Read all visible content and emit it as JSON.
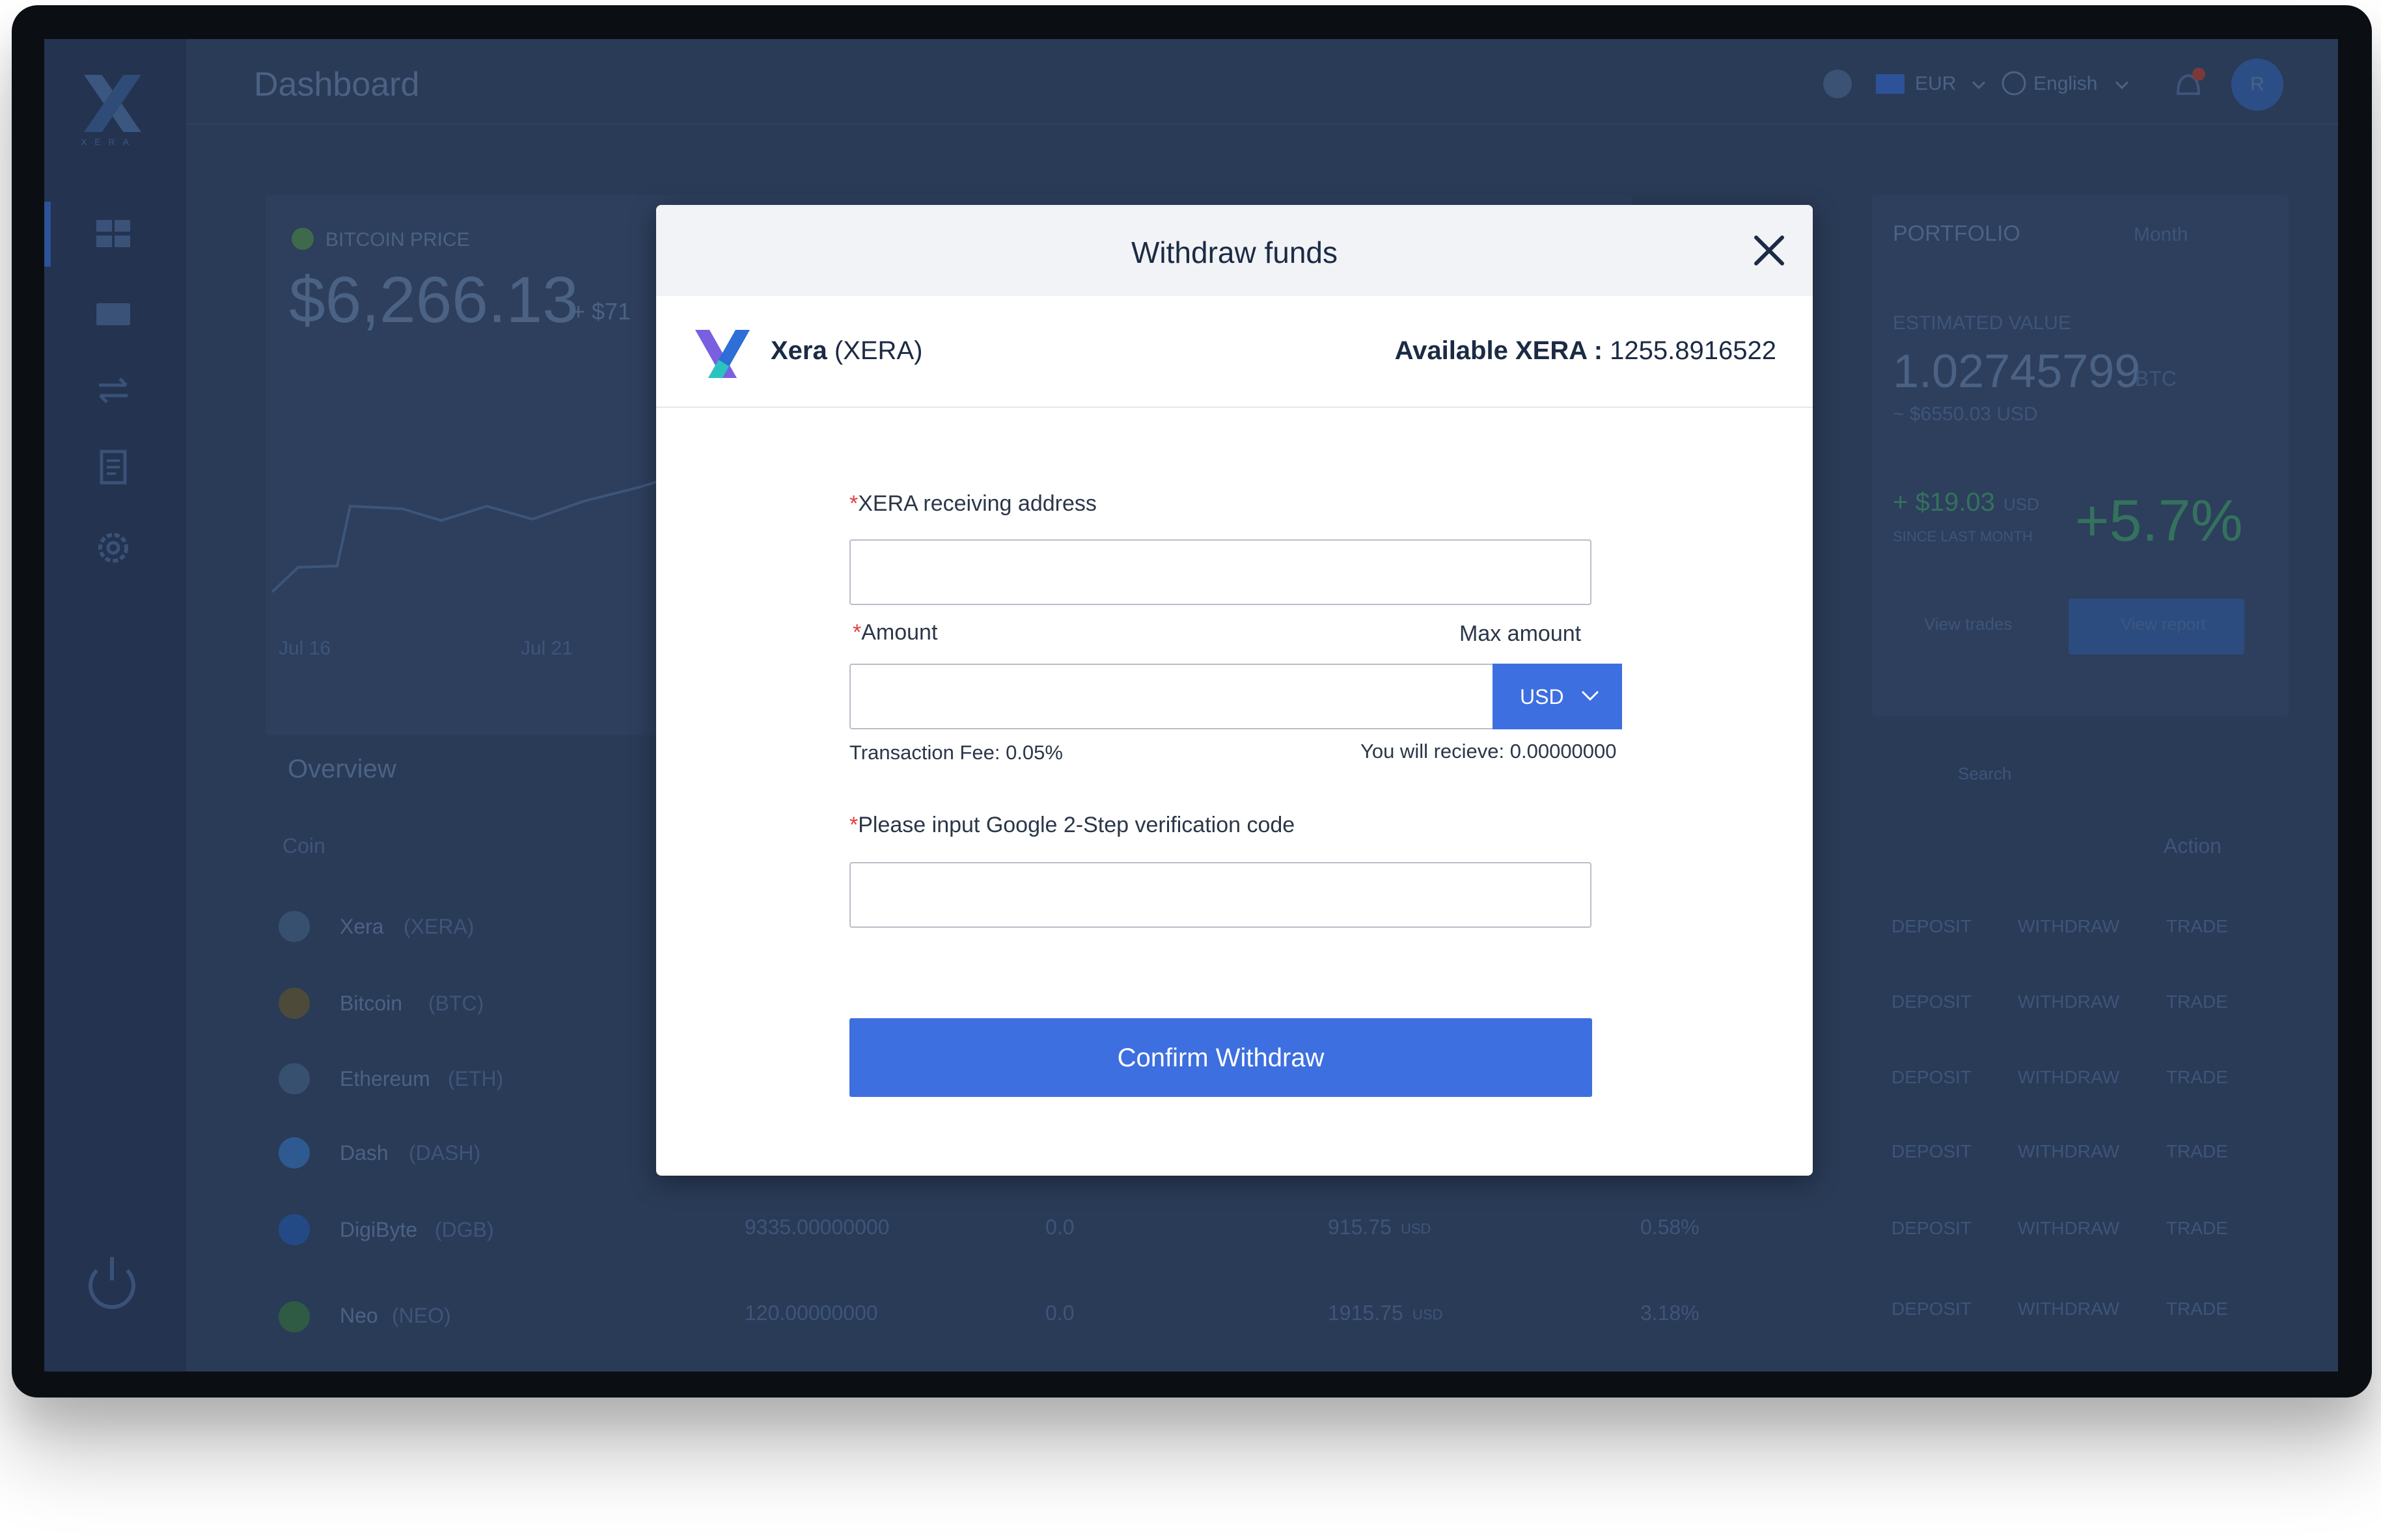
{
  "background": {
    "page_title": "Dashboard",
    "logo_text": "XERA",
    "header": {
      "currency": "EUR",
      "language": "English",
      "avatar_initial": "R"
    },
    "price_card": {
      "label": "BITCOIN PRICE",
      "value": "$6,266.13",
      "change": "+ $71",
      "x_labels": [
        "Jul 16",
        "Jul 21"
      ]
    },
    "portfolio": {
      "title": "PORTFOLIO",
      "period": "Month",
      "estimated_label": "ESTIMATED VALUE",
      "value": "1.02745799",
      "value_unit": "BTC",
      "usd_value": "~ $6550.03 USD",
      "gain": "+ $19.03",
      "gain_unit": "USD",
      "gain_caption": "SINCE LAST MONTH",
      "percent": "+5.7%",
      "view_trades": "View trades",
      "view_report": "View report"
    },
    "overview": {
      "title": "Overview",
      "col_coin": "Coin",
      "col_action": "Action",
      "search_placeholder": "Search",
      "rows": [
        {
          "name": "Xera",
          "ticker": "(XERA)",
          "balance": "",
          "pending": "",
          "value": "",
          "unit": "",
          "change": ""
        },
        {
          "name": "Bitcoin",
          "ticker": "(BTC)",
          "balance": "",
          "pending": "",
          "value": "",
          "unit": "",
          "change": ""
        },
        {
          "name": "Ethereum",
          "ticker": "(ETH)",
          "balance": "",
          "pending": "",
          "value": "",
          "unit": "",
          "change": ""
        },
        {
          "name": "Dash",
          "ticker": "(DASH)",
          "balance": "",
          "pending": "",
          "value": "",
          "unit": "",
          "change": ""
        },
        {
          "name": "DigiByte",
          "ticker": "(DGB)",
          "balance": "9335.00000000",
          "pending": "0.0",
          "value": "915.75",
          "unit": "USD",
          "change": "0.58%"
        },
        {
          "name": "Neo",
          "ticker": "(NEO)",
          "balance": "120.00000000",
          "pending": "0.0",
          "value": "1915.75",
          "unit": "USD",
          "change": "3.18%"
        }
      ],
      "actions": [
        "DEPOSIT",
        "WITHDRAW",
        "TRADE"
      ]
    }
  },
  "modal": {
    "title": "Withdraw funds",
    "coin": {
      "name": "Xera",
      "ticker": "(XERA)"
    },
    "available": {
      "label": "Available XERA :",
      "value": "1255.8916522"
    },
    "address": {
      "required_mark": "*",
      "label": "XERA receiving address",
      "value": "",
      "placeholder": ""
    },
    "amount": {
      "required_mark": "*",
      "label": "Amount",
      "max_label": "Max amount",
      "value": "",
      "placeholder": "",
      "currency": "USD"
    },
    "fee_text": "Transaction Fee: 0.05%",
    "receive_text": "You will recieve: 0.00000000",
    "code": {
      "required_mark": "*",
      "label": "Please input Google 2-Step verification code",
      "value": "",
      "placeholder": ""
    },
    "confirm_label": "Confirm Withdraw"
  },
  "colors": {
    "accent": "#3d6fe0",
    "required": "#e0403e",
    "overlay_bg": "#2a3b57"
  }
}
